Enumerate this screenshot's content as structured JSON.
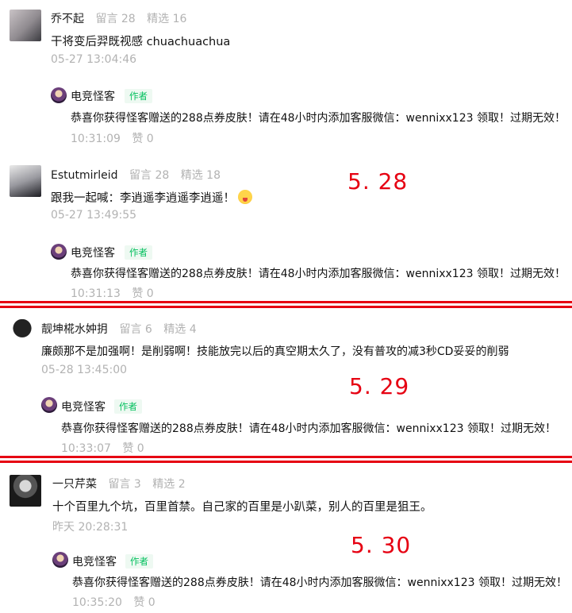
{
  "comments": [
    {
      "name": "乔不起",
      "stat1": "留言 28",
      "stat2": "精选 16",
      "text": "干将变后羿既视感 chuachuachua",
      "time": "05-27 13:04:46",
      "reply": {
        "name": "电竞怪客",
        "badge": "作者",
        "text": "恭喜你获得怪客赠送的288点券皮肤！请在48小时内添加客服微信：wennixx123 领取！过期无效！",
        "time": "10:31:09",
        "likes": "赞 0"
      }
    },
    {
      "name": "Estutmirleid",
      "stat1": "留言 28",
      "stat2": "精选 18",
      "text": "跟我一起喊：李逍遥李逍遥李逍遥！",
      "time": "05-27 13:49:55",
      "reply": {
        "name": "电竞怪客",
        "badge": "作者",
        "text": "恭喜你获得怪客赠送的288点券皮肤！请在48小时内添加客服微信：wennixx123 领取！过期无效！",
        "time": "10:31:13",
        "likes": "赞 0"
      }
    },
    {
      "name": "靓坤椛水妕抈",
      "stat1": "留言 6",
      "stat2": "精选 4",
      "text": "廉颇那不是加强啊！是削弱啊！技能放完以后的真空期太久了，没有普攻的减3秒CD妥妥的削弱",
      "time": "05-28 13:45:00",
      "reply": {
        "name": "电竞怪客",
        "badge": "作者",
        "text": "恭喜你获得怪客赠送的288点券皮肤！请在48小时内添加客服微信：wennixx123 领取！过期无效！",
        "time": "10:33:07",
        "likes": "赞 0"
      }
    },
    {
      "name": "一只芹菜",
      "stat1": "留言 3",
      "stat2": "精选 2",
      "text": "十个百里九个坑，百里首禁。自己家的百里是小趴菜，别人的百里是狙王。",
      "time": "昨天 20:28:31",
      "reply": {
        "name": "电竞怪客",
        "badge": "作者",
        "text": "恭喜你获得怪客赠送的288点券皮肤！请在48小时内添加客服微信：wennixx123 领取！过期无效！",
        "time": "10:35:20",
        "likes": "赞 0"
      }
    }
  ],
  "date_marks": [
    "5. 28",
    "5. 29",
    "5. 30"
  ],
  "colors": {
    "accent_red": "#e60012",
    "author_badge": "#07c160",
    "muted": "#b2b2b2"
  },
  "icons": {
    "emoji": "tongue-out-emoji"
  }
}
